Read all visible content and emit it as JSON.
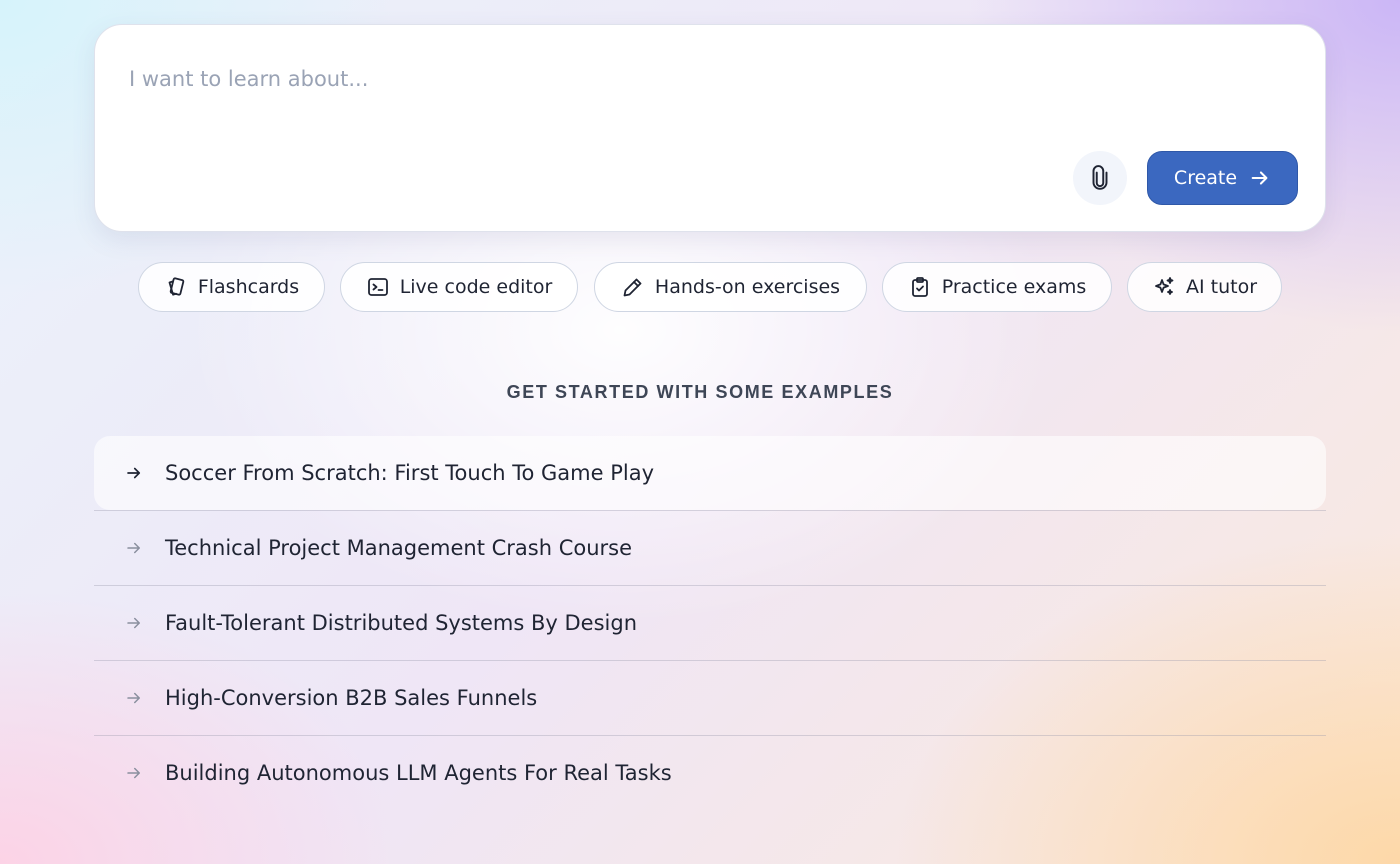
{
  "prompt": {
    "placeholder": "I want to learn about...",
    "value": "",
    "attach_icon": "paperclip-icon",
    "create_label": "Create",
    "create_icon": "arrow-right-icon",
    "accent_color": "#3b68c0"
  },
  "features": [
    {
      "label": "Flashcards",
      "icon": "cards-icon"
    },
    {
      "label": "Live code editor",
      "icon": "terminal-icon"
    },
    {
      "label": "Hands-on exercises",
      "icon": "pencil-icon"
    },
    {
      "label": "Practice exams",
      "icon": "clipboard-check-icon"
    },
    {
      "label": "AI tutor",
      "icon": "sparkles-icon"
    }
  ],
  "examples": {
    "heading": "GET STARTED WITH SOME EXAMPLES",
    "items": [
      {
        "label": "Soccer From Scratch: First Touch To Game Play",
        "icon": "arrow-right-icon",
        "highlighted": true
      },
      {
        "label": "Technical Project Management Crash Course",
        "icon": "arrow-right-icon",
        "highlighted": false
      },
      {
        "label": "Fault-Tolerant Distributed Systems By Design",
        "icon": "arrow-right-icon",
        "highlighted": false
      },
      {
        "label": "High-Conversion B2B Sales Funnels",
        "icon": "arrow-right-icon",
        "highlighted": false
      },
      {
        "label": "Building Autonomous LLM Agents For Real Tasks",
        "icon": "arrow-right-icon",
        "highlighted": false
      }
    ]
  }
}
